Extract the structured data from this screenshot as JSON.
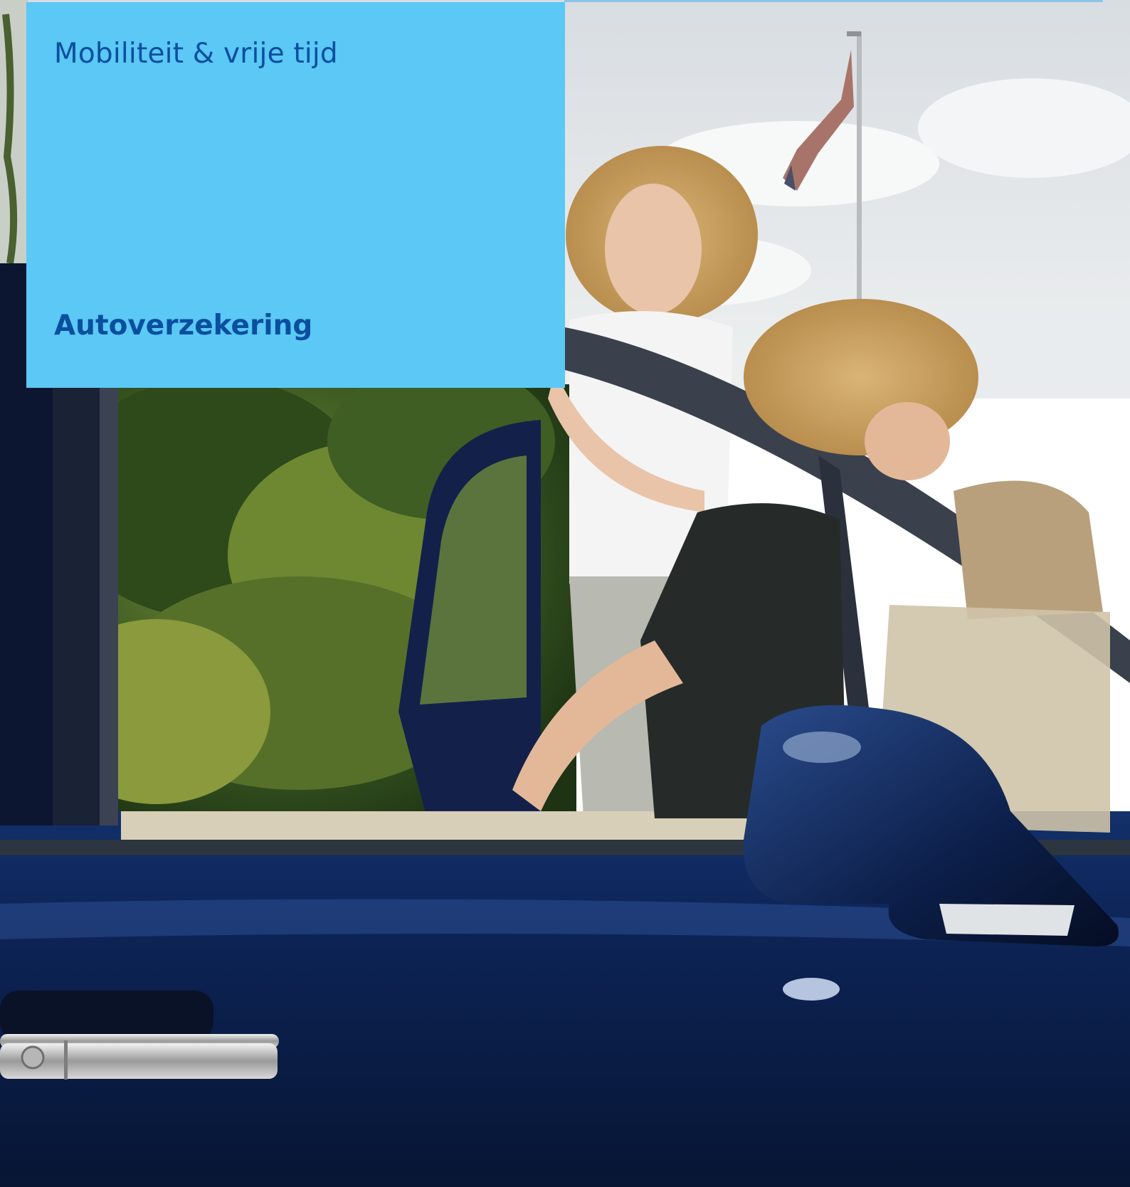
{
  "cover": {
    "section_title": "Mobiliteit & vrije tijd",
    "document_title": "Autoverzekering"
  },
  "colors": {
    "title_box": "#5bc8f5",
    "title_text": "#0a4f9e",
    "car_body": "#0d2456"
  },
  "photo": {
    "subject": "cover-photo-woman-and-girl-at-car"
  }
}
